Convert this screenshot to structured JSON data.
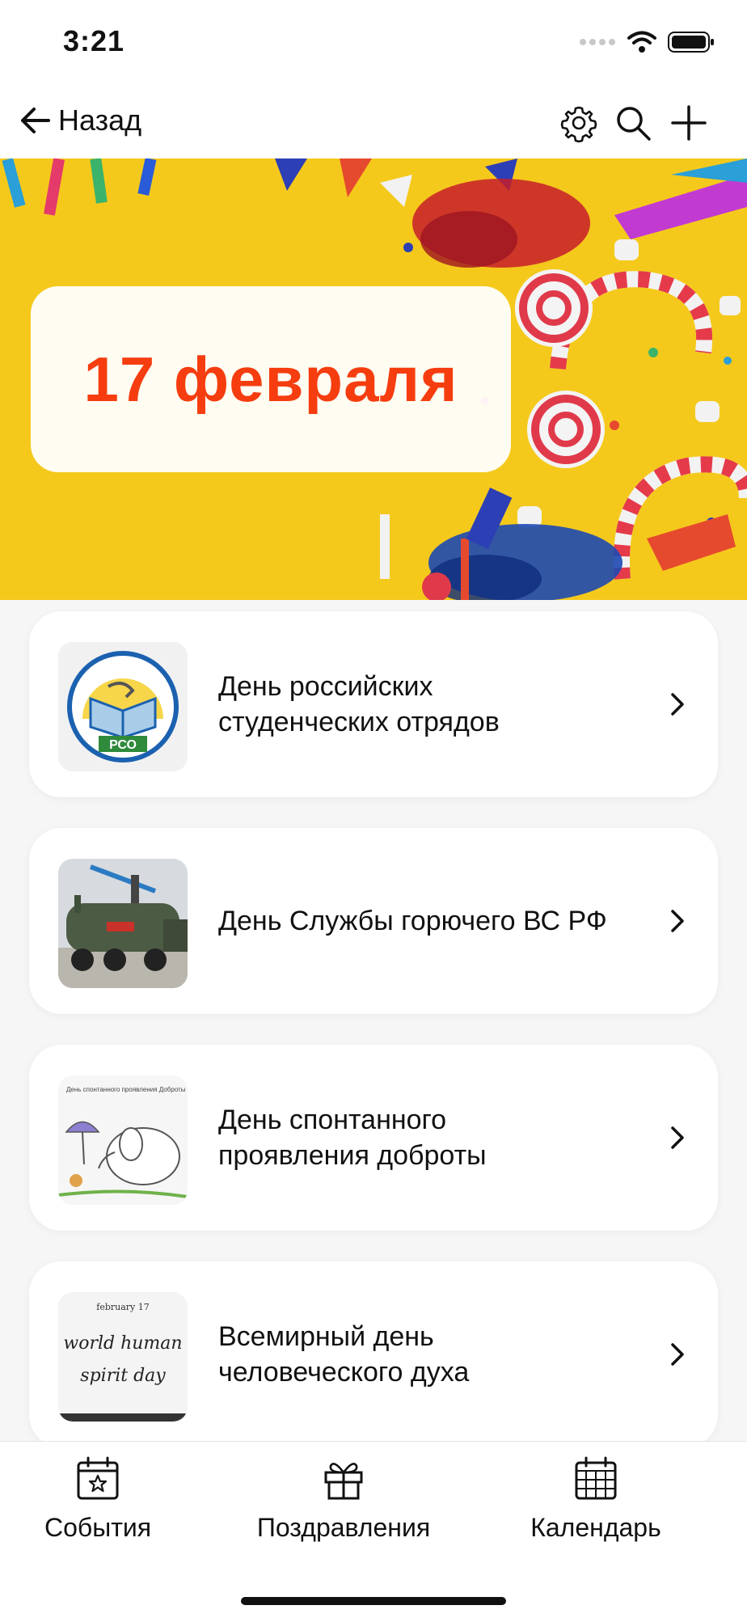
{
  "status_bar": {
    "time": "3:21"
  },
  "nav": {
    "back_label": "Назад"
  },
  "hero": {
    "date": "17 февраля"
  },
  "events": [
    {
      "title_line1": "День российских",
      "title_line2": "студенческих отрядов",
      "thumb_text": "РСО"
    },
    {
      "title_line1": "День Службы горючего ВС РФ",
      "title_line2": ""
    },
    {
      "title_line1": "День спонтанного",
      "title_line2": "проявления доброты",
      "thumb_text": "День спонтанного проявления Доброты"
    },
    {
      "title_line1": "Всемирный день",
      "title_line2": "человеческого духа",
      "thumb_text_1": "february 17",
      "thumb_text_2": "world human",
      "thumb_text_3": "spirit day"
    }
  ],
  "tabs": [
    {
      "label": "События",
      "icon": "calendar-star-icon"
    },
    {
      "label": "Поздравления",
      "icon": "gift-icon"
    },
    {
      "label": "Календарь",
      "icon": "calendar-grid-icon"
    }
  ],
  "colors": {
    "accent": "#f53d0f",
    "hero_bg": "#f5c91c"
  }
}
